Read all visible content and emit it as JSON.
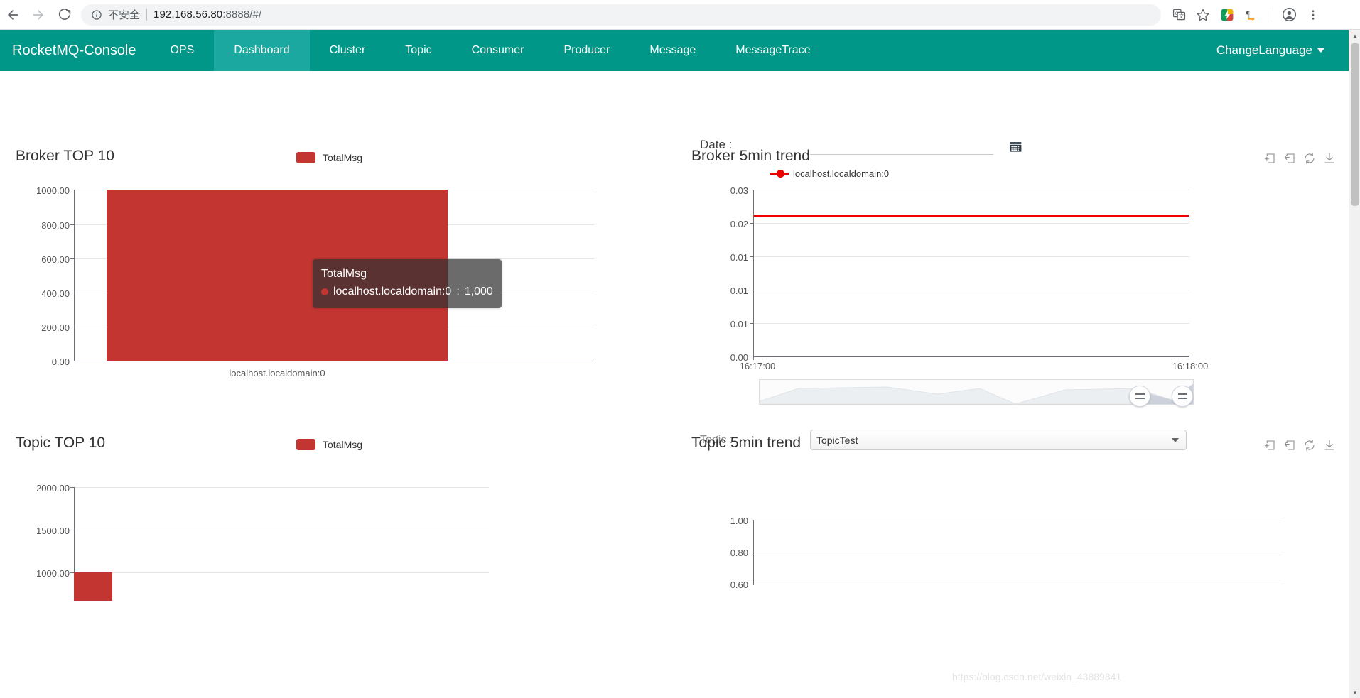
{
  "browser": {
    "back_label": "back",
    "forward_label": "forward",
    "reload_label": "reload",
    "security_text": "不安全",
    "url_host": "192.168.56.80",
    "url_rest": ":8888/#/",
    "url_full": "192.168.56.80:8888/#/",
    "icons": [
      "translate-icon",
      "bookmark-star-icon",
      "extension-icon",
      "pilcrow-extension-icon",
      "profile-avatar-icon",
      "chrome-menu-icon"
    ]
  },
  "nav": {
    "brand": "RocketMQ-Console",
    "items": [
      {
        "label": "OPS",
        "active": false
      },
      {
        "label": "Dashboard",
        "active": true
      },
      {
        "label": "Cluster",
        "active": false
      },
      {
        "label": "Topic",
        "active": false
      },
      {
        "label": "Consumer",
        "active": false
      },
      {
        "label": "Producer",
        "active": false
      },
      {
        "label": "Message",
        "active": false
      },
      {
        "label": "MessageTrace",
        "active": false
      }
    ],
    "language_label": "ChangeLanguage",
    "accent_color": "#009688",
    "accent_active_color": "#1ba8a0"
  },
  "filters": {
    "date_label": "Date :",
    "date_value": "",
    "date_placeholder": "",
    "calendar_icon": "calendar-icon",
    "topic_label": "Topic :",
    "topic_value": "TopicTest",
    "topic_options": [
      "TopicTest"
    ]
  },
  "panels": {
    "broker_top": {
      "title": "Broker TOP 10",
      "legend": "TotalMsg",
      "legend_color": "#c23531"
    },
    "broker_trend": {
      "title": "Broker 5min trend",
      "legend": "localhost.localdomain:0",
      "legend_color": "#ee0000",
      "toolbox": [
        "data-zoom-icon",
        "restore-zoom-icon",
        "refresh-icon",
        "save-image-icon"
      ]
    },
    "topic_top": {
      "title": "Topic TOP 10",
      "legend": "TotalMsg",
      "legend_color": "#c23531"
    },
    "topic_trend": {
      "title": "Topic 5min trend",
      "toolbox": [
        "data-zoom-icon",
        "restore-zoom-icon",
        "refresh-icon",
        "save-image-icon"
      ]
    }
  },
  "tooltip": {
    "title": "TotalMsg",
    "series_name": "localhost.localdomain:0",
    "separator": " : ",
    "value": "1,000",
    "marker_color": "#c23531"
  },
  "watermark": "https://blog.csdn.net/weixin_43889841",
  "chart_data": [
    {
      "id": "broker-top-10",
      "type": "bar",
      "title": "Broker TOP 10",
      "categories": [
        "localhost.localdomain:0"
      ],
      "series": [
        {
          "name": "TotalMsg",
          "values": [
            1000
          ],
          "color": "#c23531"
        }
      ],
      "xlabel": "",
      "ylabel": "",
      "ylim": [
        0,
        1000
      ],
      "yticks": [
        "0.00",
        "200.00",
        "400.00",
        "600.00",
        "800.00",
        "1000.00"
      ],
      "grid": true,
      "legend_position": "top-center"
    },
    {
      "id": "broker-5min-trend",
      "type": "line",
      "title": "Broker 5min trend",
      "x": [
        "16:17:00",
        "16:18:00"
      ],
      "series": [
        {
          "name": "localhost.localdomain:0",
          "values": [
            0.024,
            0.024
          ],
          "color": "#ee0000"
        }
      ],
      "xlabel": "",
      "ylabel": "",
      "ylim": [
        0,
        0.03
      ],
      "yticks": [
        "0.00",
        "0.01",
        "0.01",
        "0.01",
        "0.02",
        "0.03"
      ],
      "xticks": [
        "16:17:00",
        "16:18:00"
      ],
      "grid": true,
      "legend_position": "top-center",
      "datazoom": true
    },
    {
      "id": "topic-top-10",
      "type": "bar",
      "title": "Topic TOP 10",
      "categories": [
        ""
      ],
      "series": [
        {
          "name": "TotalMsg",
          "values": [
            1000
          ],
          "color": "#c23531"
        }
      ],
      "xlabel": "",
      "ylabel": "",
      "ylim": [
        0,
        2000
      ],
      "yticks": [
        "1000.00",
        "1500.00",
        "2000.00"
      ],
      "grid": true,
      "legend_position": "top-center"
    },
    {
      "id": "topic-5min-trend",
      "type": "line",
      "title": "Topic 5min trend",
      "x": [],
      "series": [],
      "xlabel": "",
      "ylabel": "",
      "ylim": [
        0.6,
        1.0
      ],
      "yticks": [
        "0.60",
        "0.80",
        "1.00"
      ],
      "grid": true
    }
  ]
}
